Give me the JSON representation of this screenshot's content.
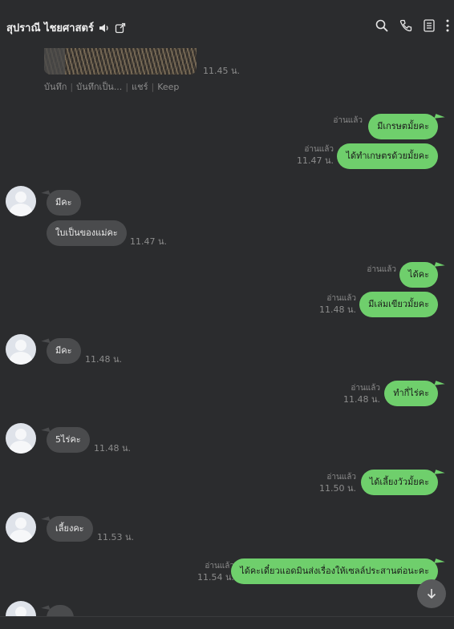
{
  "header": {
    "contact_name": "สุปราณี ไชยศาสตร์",
    "icons": [
      "speaker-icon",
      "external-link-icon",
      "search-icon",
      "phone-icon",
      "notes-icon",
      "more-vert-icon"
    ]
  },
  "media_message": {
    "time": "11.45 น.",
    "actions": [
      "บันทึก",
      "บันทึกเป็น...",
      "แชร์",
      "Keep"
    ]
  },
  "messages": [
    {
      "side": "out",
      "text": "มีเกรษตมั้ยคะ",
      "status": "อ่านแล้ว",
      "time": ""
    },
    {
      "side": "out",
      "text": "ได้ทำเกษตรด้วยมั้ยคะ",
      "status": "อ่านแล้ว",
      "time": "11.47 น."
    },
    {
      "side": "in",
      "text": "มีคะ",
      "time": ""
    },
    {
      "side": "in",
      "text": "ใบเป็นของแม่คะ",
      "time": "11.47 น."
    },
    {
      "side": "out",
      "text": "ได้คะ",
      "status": "อ่านแล้ว",
      "time": ""
    },
    {
      "side": "out",
      "text": "มีเล่มเขียวมั้ยคะ",
      "status": "อ่านแล้ว",
      "time": "11.48 น."
    },
    {
      "side": "in",
      "text": "มีคะ",
      "time": "11.48 น."
    },
    {
      "side": "out",
      "text": "ทำกี่ไร่คะ",
      "status": "อ่านแล้ว",
      "time": "11.48 น."
    },
    {
      "side": "in",
      "text": "5ไร่คะ",
      "time": "11.48 น."
    },
    {
      "side": "out",
      "text": "ได้เลี้ยงวัวมั้ยคะ",
      "status": "อ่านแล้ว",
      "time": "11.50 น."
    },
    {
      "side": "in",
      "text": "เลี้ยงคะ",
      "time": "11.53 น."
    },
    {
      "side": "out",
      "text": "ได้คะเดี๋ยวแอดมินส่งเรื่องให้เซลล์ประสานต่อนะคะ",
      "status": "อ่านแล้ว",
      "time": "11.54 น."
    }
  ],
  "colors": {
    "background": "#2b2c2e",
    "outgoing_bubble": "#6fcf6c",
    "incoming_bubble": "#4a4b4d",
    "meta_text": "#8c8c8c"
  }
}
